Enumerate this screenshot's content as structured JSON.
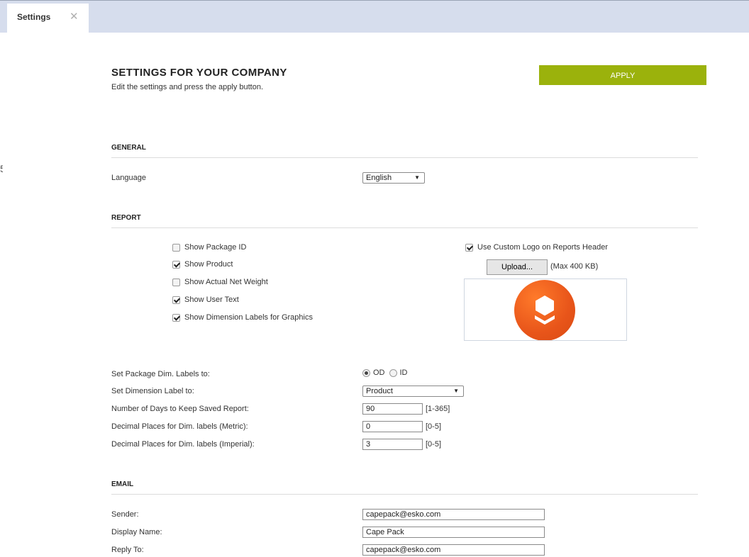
{
  "tab": {
    "label": "Settings",
    "close": "✕"
  },
  "edge_mark": "5",
  "header": {
    "title": "SETTINGS FOR YOUR COMPANY",
    "subtitle": "Edit the settings and press the apply button.",
    "apply_label": "APPLY",
    "apply_color": "#9bb20c"
  },
  "general": {
    "heading": "GENERAL",
    "language_label": "Language",
    "language_value": "English"
  },
  "report": {
    "heading": "REPORT",
    "options": [
      {
        "label": "Show Package ID",
        "checked": false
      },
      {
        "label": "Show Product",
        "checked": true
      },
      {
        "label": "Show Actual Net Weight",
        "checked": false
      },
      {
        "label": "Show User Text",
        "checked": true
      },
      {
        "label": "Show Dimension Labels for Graphics",
        "checked": true
      }
    ],
    "custom_logo_label": "Use Custom Logo on Reports Header",
    "custom_logo_checked": true,
    "upload_label": "Upload...",
    "upload_note": "(Max 400 KB)",
    "logo_icon": "esko-logo-icon",
    "logo_color": "#e8551a",
    "pkg_dim_label": "Set Package Dim. Labels to:",
    "pkg_dim_options": {
      "od": "OD",
      "id": "ID"
    },
    "pkg_dim_selected": "OD",
    "dim_label_label": "Set Dimension Label to:",
    "dim_label_value": "Product",
    "days_label": "Number of Days to Keep Saved Report:",
    "days_value": "90",
    "days_range": "[1-365]",
    "metric_label": "Decimal Places for Dim. labels (Metric):",
    "metric_value": "0",
    "metric_range": "[0-5]",
    "imperial_label": "Decimal Places for Dim. labels (Imperial):",
    "imperial_value": "3",
    "imperial_range": "[0-5]"
  },
  "email": {
    "heading": "EMAIL",
    "sender_label": "Sender:",
    "sender_value": "capepack@esko.com",
    "display_label": "Display Name:",
    "display_value": "Cape Pack",
    "reply_label": "Reply To:",
    "reply_value": "capepack@esko.com"
  }
}
